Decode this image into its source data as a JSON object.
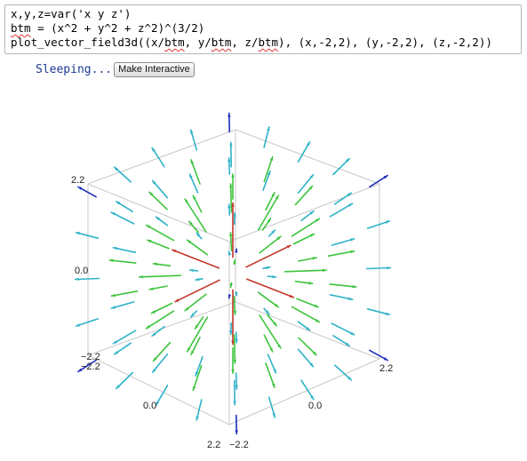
{
  "cell": {
    "lines": [
      {
        "parts": [
          {
            "t": "x,y,z=var('x y z')",
            "u": false
          }
        ]
      },
      {
        "parts": [
          {
            "t": "btm",
            "u": true
          },
          {
            "t": " = (x^2 + y^2 + z^2)^(3/2)",
            "u": false
          }
        ]
      },
      {
        "parts": [
          {
            "t": "plot_vector_field3d((x/",
            "u": false
          },
          {
            "t": "btm",
            "u": true
          },
          {
            "t": ", y/",
            "u": false
          },
          {
            "t": "btm",
            "u": true
          },
          {
            "t": ", z/",
            "u": false
          },
          {
            "t": "btm",
            "u": true
          },
          {
            "t": "), (x,-2,2), (y,-2,2), (z,-2,2))",
            "u": false
          }
        ]
      }
    ]
  },
  "status": {
    "sleeping_label": "Sleeping...",
    "make_interactive_label": "Make Interactive"
  },
  "plot": {
    "axis_labels": {
      "z_max": "2.2",
      "z_mid": "0.0",
      "z_min": "−2.2",
      "x_min": "−2.2",
      "x_mid": "0.0",
      "x_max": "2.2",
      "y_min": "−2.2",
      "y_mid": "0.0",
      "y_max": "2.2"
    },
    "colors": {
      "frame": "#c8c8c8",
      "arrow_blue": "#1d2fb8",
      "arrow_cyan": "#2fb3c9",
      "arrow_green": "#3cc43c",
      "arrow_red": "#c4352a"
    }
  }
}
